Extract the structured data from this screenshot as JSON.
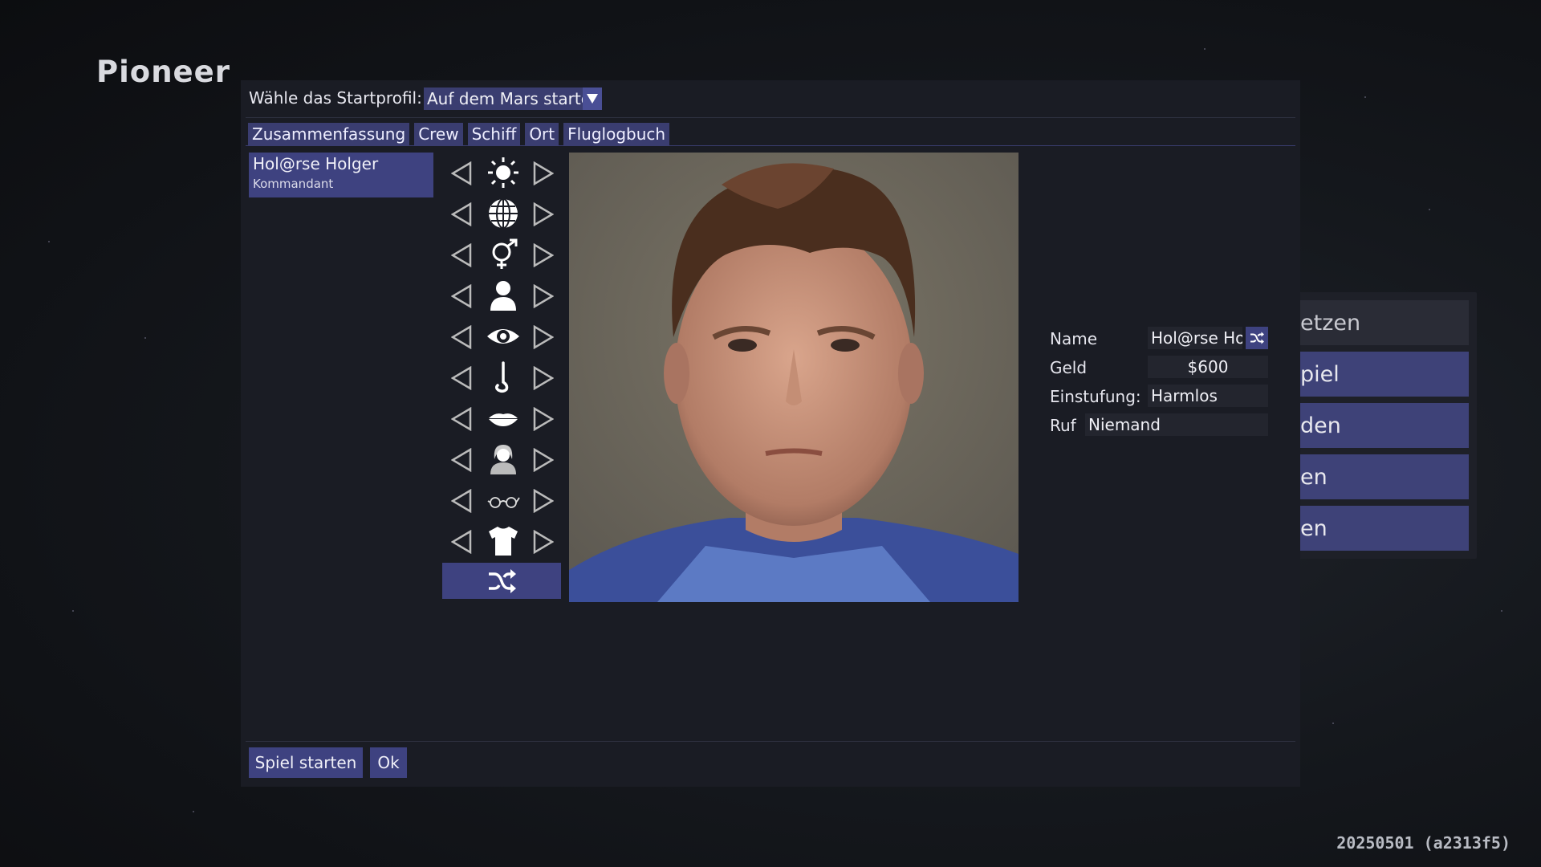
{
  "app": {
    "logo": "Pioneer",
    "version": "20250501 (a2313f5)"
  },
  "background_menu": {
    "items": [
      "etzen",
      "piel",
      "den",
      "en",
      "en"
    ]
  },
  "dialog": {
    "profile_label": "Wähle das Startprofil:",
    "profile_value": "Auf dem Mars starten",
    "tabs": [
      "Zusammenfassung",
      "Crew",
      "Schiff",
      "Ort",
      "Fluglogbuch"
    ],
    "crew": [
      {
        "name": "Hol@rse Holger",
        "role": "Kommandant"
      }
    ],
    "face_features": [
      {
        "name": "brightness",
        "icon": "sun-icon"
      },
      {
        "name": "ethnicity",
        "icon": "globe-icon"
      },
      {
        "name": "gender",
        "icon": "gender-icon"
      },
      {
        "name": "head",
        "icon": "person-icon"
      },
      {
        "name": "eyes",
        "icon": "eye-icon"
      },
      {
        "name": "nose",
        "icon": "nose-icon"
      },
      {
        "name": "mouth",
        "icon": "lips-icon"
      },
      {
        "name": "hair",
        "icon": "hair-icon"
      },
      {
        "name": "accessories",
        "icon": "glasses-icon"
      },
      {
        "name": "clothes",
        "icon": "shirt-icon"
      }
    ],
    "randomize_icon": "shuffle-icon",
    "info": {
      "name_label": "Name",
      "name_value": "Hol@rse Holger",
      "money_label": "Geld",
      "money_value": "$600",
      "rating_label": "Einstufung:",
      "rating_value": "Harmlos",
      "reputation_label": "Ruf",
      "reputation_value": "Niemand"
    },
    "buttons": {
      "start": "Spiel starten",
      "ok": "Ok"
    }
  },
  "colors": {
    "accent": "#3e4280",
    "panel": "#1a1c24"
  }
}
